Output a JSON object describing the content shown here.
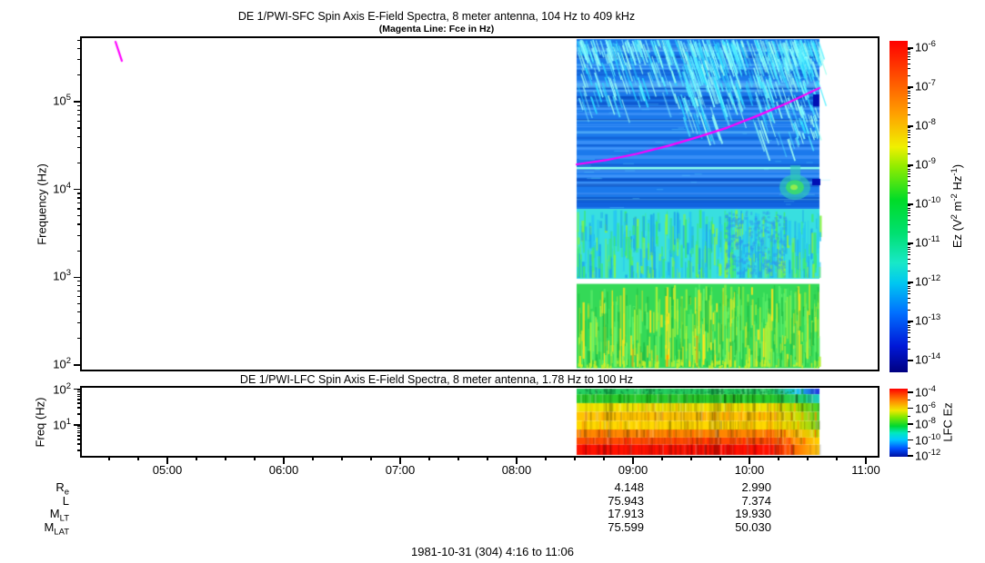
{
  "page": {
    "background": "#ffffff",
    "caption": "1981-10-31 (304) 4:16 to 11:06"
  },
  "xaxis": {
    "tick_labels": [
      "05:00",
      "06:00",
      "07:00",
      "08:00",
      "09:00",
      "10:00",
      "11:00"
    ],
    "minor_interval_minutes": 15,
    "range": [
      "04:16",
      "11:06"
    ]
  },
  "ephemeris": {
    "rows": [
      {
        "main": "R",
        "sub": "e"
      },
      {
        "main": "L",
        "sub": ""
      },
      {
        "main": "M",
        "sub": "LT"
      },
      {
        "main": "M",
        "sub": "LAT"
      }
    ],
    "columns": [
      {
        "under_time": "09:00",
        "values": [
          "4.148",
          "75.943",
          "17.913",
          "75.599"
        ]
      },
      {
        "under_time": "10:00",
        "values": [
          "2.990",
          "7.374",
          "19.930",
          "50.030"
        ]
      }
    ]
  },
  "chart_data": [
    {
      "type": "heatmap",
      "title": "DE 1/PWI-SFC  Spin Axis E-Field Spectra, 8 meter antenna, 104 Hz to 409 kHz",
      "subtitle": "(Magenta Line: Fce in Hz)",
      "ylabel": "Frequency (Hz)",
      "y_scale": "log",
      "y_range_hz": [
        104,
        409000
      ],
      "ytick_exponents": [
        2,
        3,
        4,
        5
      ],
      "x_range": [
        "04:16",
        "11:06"
      ],
      "data_coverage": [
        "08:31",
        "10:36"
      ],
      "colorbar": {
        "label_segments": [
          [
            "t",
            "Ez (V"
          ],
          [
            "s",
            "2"
          ],
          [
            "t",
            " m"
          ],
          [
            "s",
            "-2"
          ],
          [
            "t",
            " Hz"
          ],
          [
            "s",
            "-1"
          ],
          [
            "t",
            ")"
          ]
        ],
        "tick_exponents": [
          -6,
          -7,
          -8,
          -9,
          -10,
          -11,
          -12,
          -13,
          -14
        ],
        "range": [
          1e-14,
          1e-06
        ],
        "stops": [
          [
            0,
            "#000080"
          ],
          [
            0.08,
            "#0018D8"
          ],
          [
            0.18,
            "#0070FF"
          ],
          [
            0.27,
            "#00C8F0"
          ],
          [
            0.33,
            "#18E8C8"
          ],
          [
            0.42,
            "#00E070"
          ],
          [
            0.52,
            "#00DC28"
          ],
          [
            0.62,
            "#90EC00"
          ],
          [
            0.68,
            "#F0F000"
          ],
          [
            0.78,
            "#FFA000"
          ],
          [
            0.9,
            "#FF4800"
          ],
          [
            1,
            "#FF0000"
          ]
        ]
      },
      "features": {
        "fce_line_color": "#FF00FF",
        "fce_points": [
          [
            0,
            19300
          ],
          [
            0.12,
            21500
          ],
          [
            0.25,
            25500
          ],
          [
            0.38,
            31500
          ],
          [
            0.5,
            39500
          ],
          [
            0.62,
            50500
          ],
          [
            0.75,
            70000
          ],
          [
            0.87,
            97000
          ],
          [
            1,
            143000
          ]
        ],
        "early_fce_segment_page": [
          [
            127,
            480000
          ],
          [
            134,
            291000
          ]
        ],
        "narrowband_line_hz": 17500,
        "narrowband_line_color": "#8CFFF2",
        "akr_streaks": {
          "freq_hz": [
            40000,
            500000
          ],
          "color_palette": [
            "#8CFFFF",
            "#55EFFF",
            "#2BD9FF",
            "#9FFFF0"
          ],
          "level": "~1e-12"
        },
        "emission_blob": {
          "time": "10:23",
          "freq_hz": 10600,
          "colors": [
            "#2FC9B8",
            "#3BDC6E",
            "#9CF04A"
          ]
        }
      },
      "bands": [
        {
          "name": "blue background",
          "hz": [
            6000,
            530000
          ],
          "color": "#1B79EC",
          "kind": "blue",
          "level": "~1e-13"
        },
        {
          "name": "cyan hiss band",
          "hz": [
            960,
            6000
          ],
          "color": "#38DFE0",
          "kind": "cyan",
          "level": "~1e-12 to 1e-11"
        },
        {
          "name": "instrument gap",
          "hz": [
            850,
            960
          ],
          "color": "#FFFFFF",
          "kind": "gap"
        },
        {
          "name": "green LF band",
          "hz": [
            92,
            850
          ],
          "color": "#34D957",
          "kind": "green",
          "level": "~1e-10 with 1e-9 streaks"
        }
      ],
      "palettes": {
        "blue_stripes": [
          "rgba(80,160,255,0.55)",
          "rgba(10,80,200,0.5)",
          "rgba(120,210,255,0.5)",
          "rgba(0,60,170,0.45)"
        ],
        "cyan_band": [
          "#27C7F2",
          "#3BE87A",
          "#86F542",
          "#1FA9E9"
        ],
        "green_band": [
          "#22BE45",
          "#5FF06B",
          "#AEF23A",
          "#FFE51E",
          "#FF9C00"
        ]
      }
    },
    {
      "type": "heatmap",
      "title": "DE 1/PWI-LFC  Spin Axis E-Field Spectra, 8 meter antenna, 1.78 Hz to 100 Hz",
      "ylabel": "Freq (Hz)",
      "y_scale": "log",
      "y_range_hz": [
        1.78,
        100
      ],
      "ytick_exponents": [
        2,
        1
      ],
      "data_coverage": [
        "08:31",
        "10:36"
      ],
      "colorbar": {
        "label": "LFC Ez",
        "tick_exponents": [
          -4,
          -6,
          -8,
          -10,
          -12
        ],
        "range": [
          1e-12,
          0.0001
        ],
        "stops": [
          [
            0,
            "#0010A0"
          ],
          [
            0.12,
            "#0050FF"
          ],
          [
            0.25,
            "#00C8FF"
          ],
          [
            0.35,
            "#00E8C0"
          ],
          [
            0.45,
            "#00D830"
          ],
          [
            0.58,
            "#80E800"
          ],
          [
            0.68,
            "#F0E800"
          ],
          [
            0.8,
            "#FF9800"
          ],
          [
            0.92,
            "#FF4000"
          ],
          [
            1,
            "#FF0000"
          ]
        ]
      },
      "rows": [
        {
          "freq_hz": [
            70,
            100
          ],
          "color": "#24CF60",
          "right1": "#19C3EE",
          "right2": "#2430E0",
          "stripe": "#0D9C44"
        },
        {
          "freq_hz": [
            40,
            70
          ],
          "color": "#2BCB2B",
          "right1": "#24CF60",
          "right2": "#1ECAC4",
          "stripe": "#0F8F0F"
        },
        {
          "freq_hz": [
            23,
            40
          ],
          "color": "#EFE400",
          "right1": "#9EDC00",
          "right2": "#3FD32F",
          "stripe": "#FFB300"
        },
        {
          "freq_hz": [
            13,
            23
          ],
          "color": "#FFC400",
          "right1": "#CBDD00",
          "right2": "#55D52A",
          "stripe": "#FF8A00"
        },
        {
          "freq_hz": [
            7.5,
            13
          ],
          "color": "#FFD800",
          "right1": "#D8DC00",
          "right2": "#7ED81E",
          "stripe": "#FFA000"
        },
        {
          "freq_hz": [
            4.5,
            7.5
          ],
          "color": "#FF8600",
          "right1": "#FFBE00",
          "right2": "#C9D900",
          "stripe": "#FF5A00"
        },
        {
          "freq_hz": [
            2.9,
            4.5
          ],
          "color": "#FF4A00",
          "right1": "#FF9400",
          "right2": "#FFD400",
          "stripe": "#FF2600"
        },
        {
          "freq_hz": [
            1.3,
            2.9
          ],
          "color": "#FF1200",
          "right1": "#FF7A00",
          "right2": "#FFCC14",
          "stripe": "#E60000"
        }
      ]
    }
  ]
}
